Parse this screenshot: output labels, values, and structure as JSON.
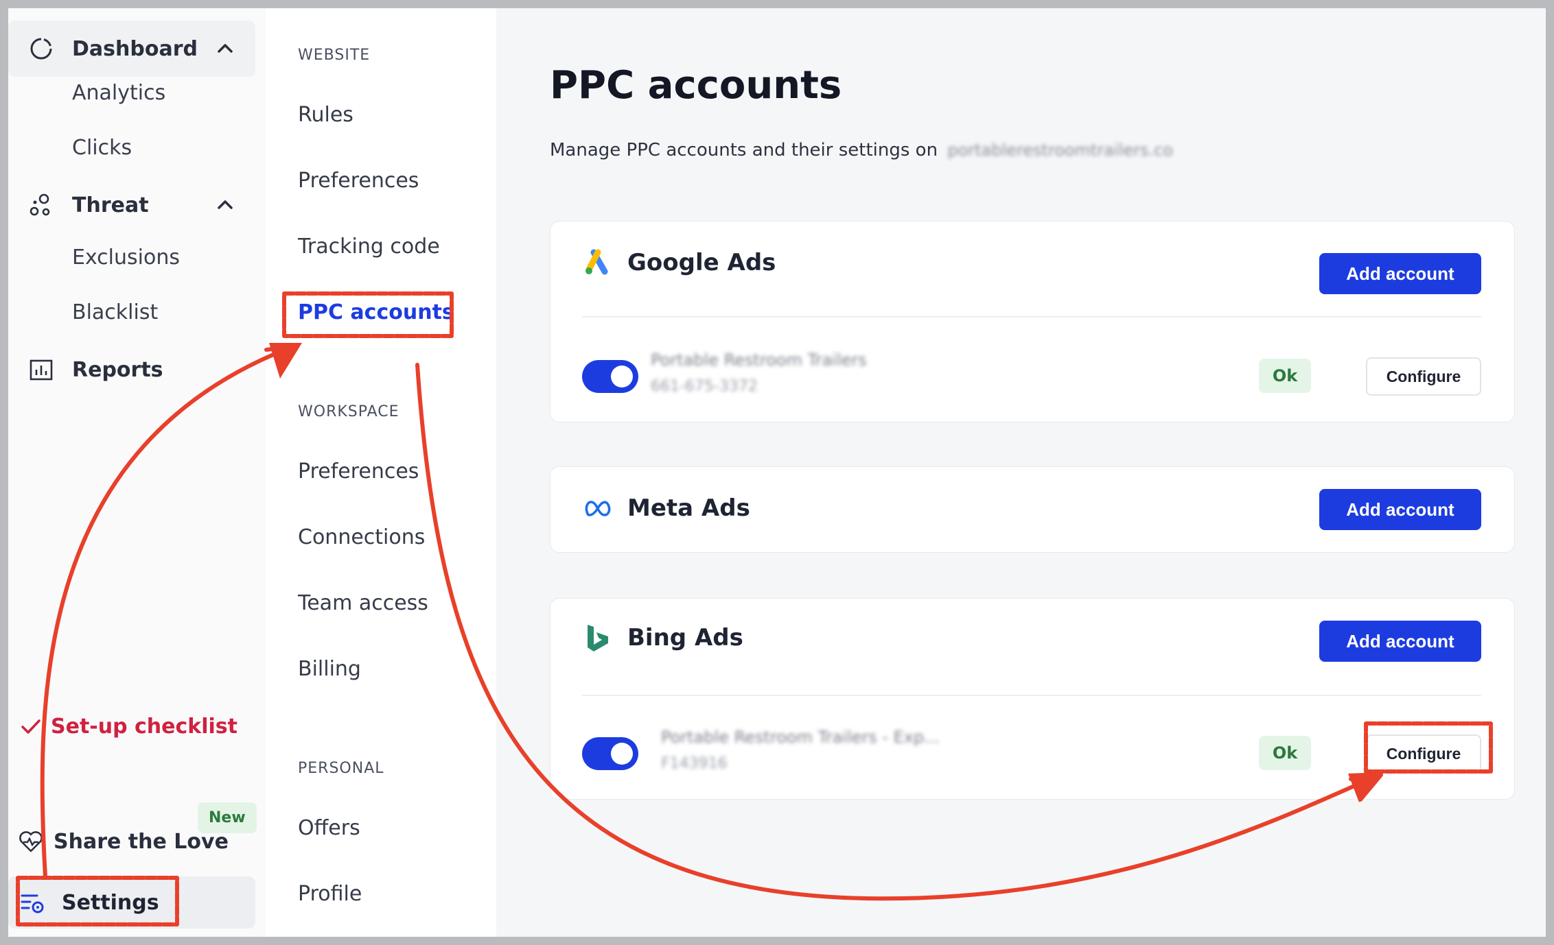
{
  "sidebar": {
    "dashboard": "Dashboard",
    "analytics": "Analytics",
    "clicks": "Clicks",
    "threat": "Threat",
    "exclusions": "Exclusions",
    "blacklist": "Blacklist",
    "reports": "Reports",
    "checklist": "Set-up checklist",
    "share": "Share the Love",
    "new_badge": "New",
    "settings": "Settings"
  },
  "subnav": {
    "website_label": "WEBSITE",
    "rules": "Rules",
    "preferences": "Preferences",
    "tracking_code": "Tracking code",
    "ppc_accounts": "PPC accounts",
    "workspace_label": "WORKSPACE",
    "ws_preferences": "Preferences",
    "connections": "Connections",
    "team_access": "Team access",
    "billing": "Billing",
    "personal_label": "PERSONAL",
    "offers": "Offers",
    "profile": "Profile"
  },
  "main": {
    "title": "PPC accounts",
    "subtitle": "Manage PPC accounts and their settings on",
    "site_blurred": "portablerestroomtrailers.co",
    "providers": [
      {
        "name": "Google Ads",
        "add_label": "Add account",
        "account": {
          "name": "Portable Restroom Trailers",
          "id": "661-675-3372",
          "status": "Ok",
          "configure": "Configure"
        }
      },
      {
        "name": "Meta Ads",
        "add_label": "Add account"
      },
      {
        "name": "Bing Ads",
        "add_label": "Add account",
        "account": {
          "name": "Portable Restroom Trailers - Exp...",
          "id": "F143916",
          "status": "Ok",
          "configure": "Configure"
        }
      }
    ]
  },
  "colors": {
    "accent": "#1d3ce0",
    "annotation": "#e8402a",
    "checklist": "#d0213f"
  },
  "icons": [
    "dashboard-icon",
    "chevron-up-icon",
    "threat-icon",
    "reports-icon",
    "check-icon",
    "heart-icon",
    "settings-icon",
    "google-ads-icon",
    "meta-icon",
    "bing-icon"
  ]
}
